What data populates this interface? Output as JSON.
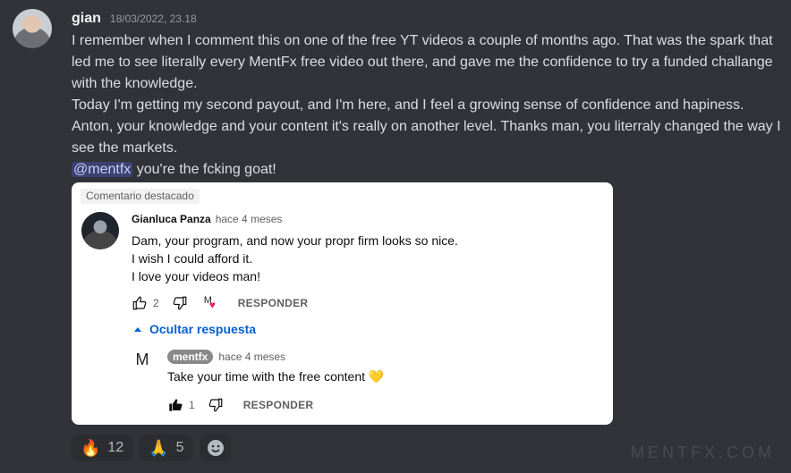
{
  "message": {
    "username": "gian",
    "timestamp": "18/03/2022, 23.18",
    "lines": [
      "I remember when I comment this on one of the free YT videos a couple of months ago. That was the spark that led me to see literally every MentFx free video out there, and gave me the confidence to try a funded challange with the knowledge.",
      "Today I'm getting my second payout, and I'm here, and I feel a growing sense of confidence and hapiness. Anton, your knowledge and your content it's really on another level. Thanks man, you literraly changed the way I see the markets."
    ],
    "mention": "@mentfx",
    "last_line": " you're the fcking goat!"
  },
  "embed": {
    "tag": "Comentario destacado",
    "comment": {
      "author": "Gianluca Panza",
      "ago": "hace 4 meses",
      "lines": [
        "Dam, your program, and now your propr firm looks so nice.",
        "I wish I could afford it.",
        "I love your videos man!"
      ],
      "likes": "2",
      "reply_label": "RESPONDER"
    },
    "hide_replies": "Ocultar respuesta",
    "reply": {
      "logo": "M",
      "author": "mentfx",
      "ago": "hace 4 meses",
      "text": "Take your time with the free content",
      "emoji": "💛",
      "likes": "1",
      "reply_label": "RESPONDER"
    }
  },
  "reactions": [
    {
      "emoji": "🔥",
      "count": "12"
    },
    {
      "emoji": "🙏",
      "count": "5"
    }
  ],
  "watermark": "MENTFX.COM",
  "colors": {
    "background": "#313338",
    "mention_bg": "#3c4270",
    "link_blue": "#065fd4"
  }
}
